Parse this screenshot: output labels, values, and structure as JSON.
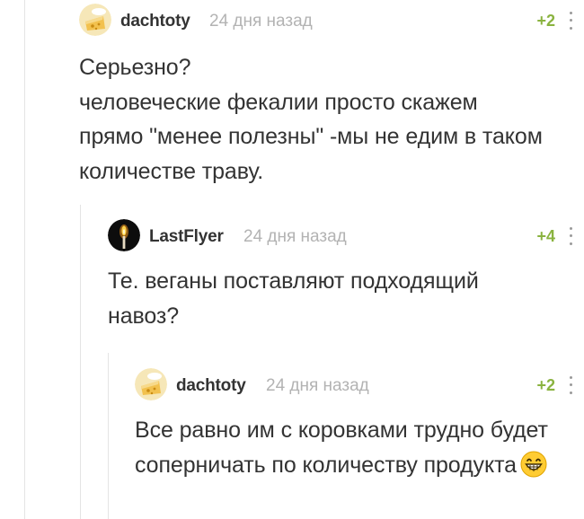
{
  "comments": [
    {
      "author": "dachtoty",
      "time": "24 дня назад",
      "rating": "+2",
      "avatar_icon": "cheese-avatar-icon",
      "body": "Серьезно?\nчеловеческие фекалии просто скажем прямо \"менее полезны\" -мы не едим в таком количестве траву."
    },
    {
      "author": "LastFlyer",
      "time": "24 дня назад",
      "rating": "+4",
      "avatar_icon": "candle-avatar-icon",
      "body": "Те. веганы поставляют подходящий навоз?"
    },
    {
      "author": "dachtoty",
      "time": "24 дня назад",
      "rating": "+2",
      "avatar_icon": "cheese-avatar-icon",
      "body": "Все равно им с коровками трудно будет соперничать по количеству продукта",
      "emoji": "grinning-face-emoji"
    }
  ],
  "colors": {
    "rating_positive": "#8ab33f",
    "time_gray": "#b3b3b3",
    "thread_line": "#e4e4e4"
  }
}
